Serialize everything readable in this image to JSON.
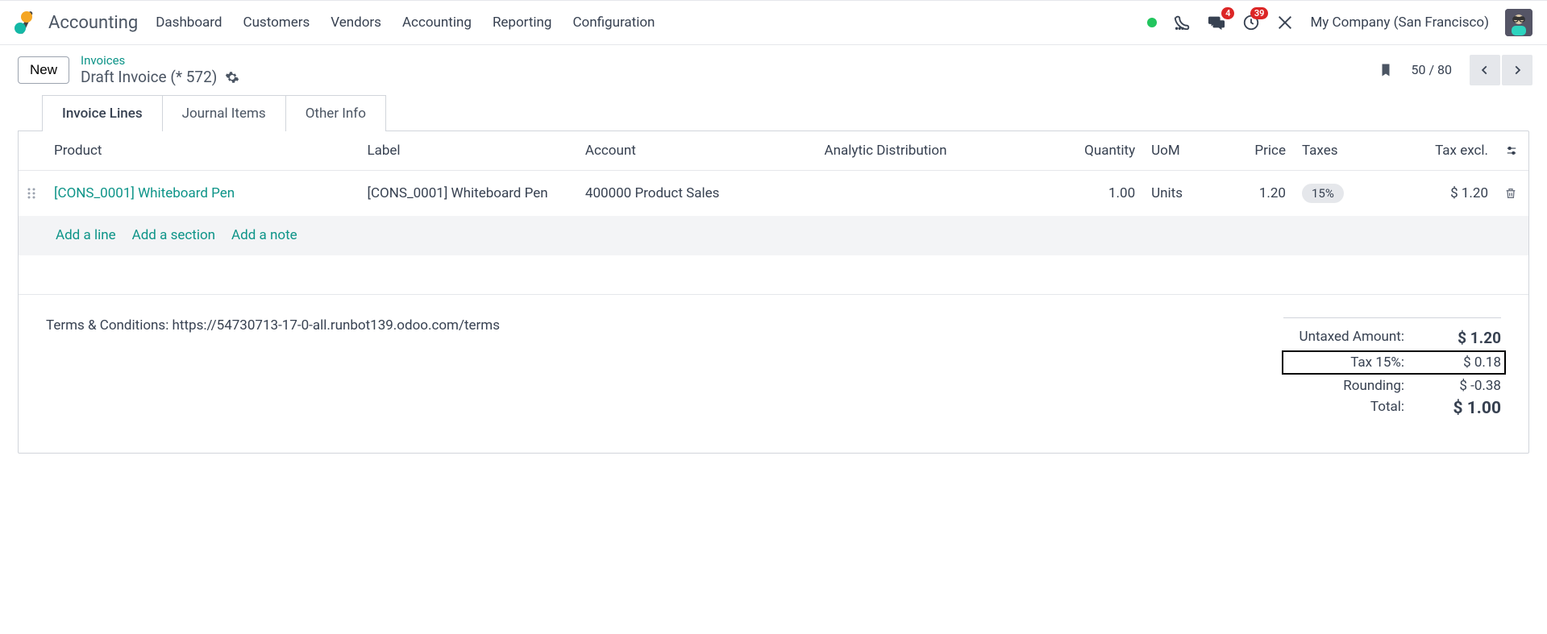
{
  "header": {
    "app_title": "Accounting",
    "nav": [
      "Dashboard",
      "Customers",
      "Vendors",
      "Accounting",
      "Reporting",
      "Configuration"
    ],
    "badges": {
      "messages": "4",
      "activities": "39"
    },
    "company": "My Company (San Francisco)"
  },
  "breadcrumb": {
    "new_label": "New",
    "parent": "Invoices",
    "title": "Draft Invoice (* 572)",
    "pager": "50 / 80"
  },
  "tabs": [
    "Invoice Lines",
    "Journal Items",
    "Other Info"
  ],
  "columns": {
    "product": "Product",
    "label": "Label",
    "account": "Account",
    "analytic": "Analytic Distribution",
    "quantity": "Quantity",
    "uom": "UoM",
    "price": "Price",
    "taxes": "Taxes",
    "tax_excl": "Tax excl."
  },
  "line": {
    "product": "[CONS_0001] Whiteboard Pen",
    "label": "[CONS_0001] Whiteboard Pen",
    "account": "400000 Product Sales",
    "analytic": "",
    "quantity": "1.00",
    "uom": "Units",
    "price": "1.20",
    "tax_chip": "15%",
    "tax_excl": "$ 1.20"
  },
  "add": {
    "line": "Add a line",
    "section": "Add a section",
    "note": "Add a note"
  },
  "terms": "Terms & Conditions: https://54730713-17-0-all.runbot139.odoo.com/terms",
  "totals": {
    "untaxed_label": "Untaxed Amount:",
    "untaxed_value": "$ 1.20",
    "tax_label": "Tax 15%:",
    "tax_value": "$ 0.18",
    "rounding_label": "Rounding:",
    "rounding_value": "$ -0.38",
    "total_label": "Total:",
    "total_value": "$ 1.00"
  }
}
